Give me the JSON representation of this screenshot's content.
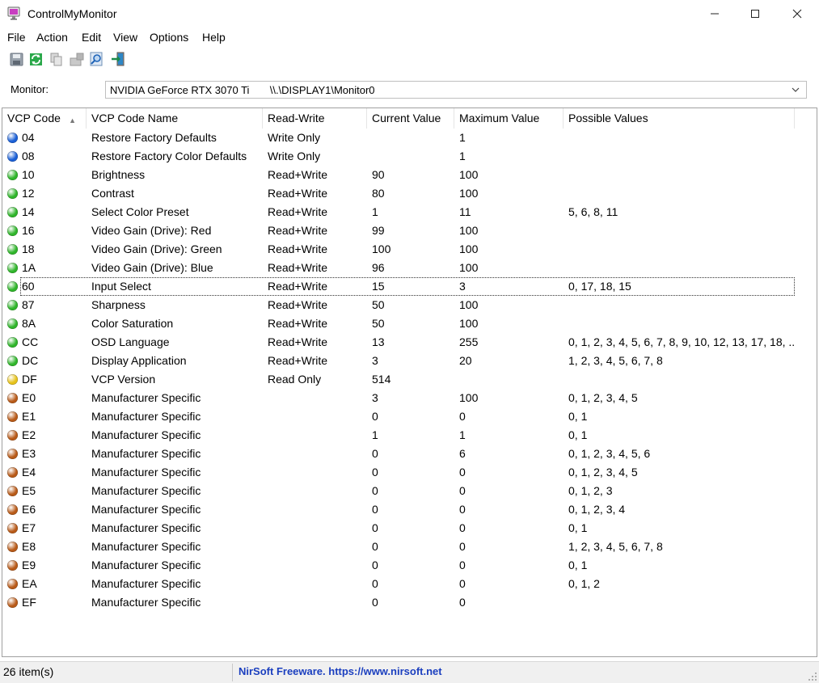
{
  "window": {
    "title": "ControlMyMonitor"
  },
  "menu": [
    "File",
    "Action",
    "Edit",
    "View",
    "Options",
    "Help"
  ],
  "toolbar": [
    "save-icon",
    "refresh-icon",
    "copy-icon",
    "properties-icon",
    "find-icon",
    "exit-icon"
  ],
  "monitor": {
    "label": "Monitor:",
    "value": "NVIDIA GeForce RTX 3070 Ti       \\\\.\\DISPLAY1\\Monitor0"
  },
  "columns": [
    "VCP Code",
    "VCP Code Name",
    "Read-Write",
    "Current Value",
    "Maximum Value",
    "Possible Values"
  ],
  "colors": {
    "blue": "#1a5fd6",
    "green": "#2fb52a",
    "yellow": "#e6c21a",
    "orange": "#b85a18"
  },
  "rows": [
    {
      "code": "04",
      "name": "Restore Factory Defaults",
      "rw": "Write Only",
      "current": "",
      "max": "1",
      "possible": "",
      "color": "blue"
    },
    {
      "code": "08",
      "name": "Restore Factory Color Defaults",
      "rw": "Write Only",
      "current": "",
      "max": "1",
      "possible": "",
      "color": "blue"
    },
    {
      "code": "10",
      "name": "Brightness",
      "rw": "Read+Write",
      "current": "90",
      "max": "100",
      "possible": "",
      "color": "green"
    },
    {
      "code": "12",
      "name": "Contrast",
      "rw": "Read+Write",
      "current": "80",
      "max": "100",
      "possible": "",
      "color": "green"
    },
    {
      "code": "14",
      "name": "Select Color Preset",
      "rw": "Read+Write",
      "current": "1",
      "max": "11",
      "possible": "5, 6, 8, 11",
      "color": "green"
    },
    {
      "code": "16",
      "name": "Video Gain (Drive): Red",
      "rw": "Read+Write",
      "current": "99",
      "max": "100",
      "possible": "",
      "color": "green"
    },
    {
      "code": "18",
      "name": "Video Gain (Drive): Green",
      "rw": "Read+Write",
      "current": "100",
      "max": "100",
      "possible": "",
      "color": "green"
    },
    {
      "code": "1A",
      "name": "Video Gain (Drive): Blue",
      "rw": "Read+Write",
      "current": "96",
      "max": "100",
      "possible": "",
      "color": "green"
    },
    {
      "code": "60",
      "name": "Input Select",
      "rw": "Read+Write",
      "current": "15",
      "max": "3",
      "possible": "0, 17, 18, 15",
      "color": "green",
      "focused": true
    },
    {
      "code": "87",
      "name": "Sharpness",
      "rw": "Read+Write",
      "current": "50",
      "max": "100",
      "possible": "",
      "color": "green"
    },
    {
      "code": "8A",
      "name": "Color Saturation",
      "rw": "Read+Write",
      "current": "50",
      "max": "100",
      "possible": "",
      "color": "green"
    },
    {
      "code": "CC",
      "name": "OSD Language",
      "rw": "Read+Write",
      "current": "13",
      "max": "255",
      "possible": "0, 1, 2, 3, 4, 5, 6, 7, 8, 9, 10, 12, 13, 17, 18, ...",
      "color": "green"
    },
    {
      "code": "DC",
      "name": "Display Application",
      "rw": "Read+Write",
      "current": "3",
      "max": "20",
      "possible": "1, 2, 3, 4, 5, 6, 7, 8",
      "color": "green"
    },
    {
      "code": "DF",
      "name": "VCP Version",
      "rw": "Read Only",
      "current": "514",
      "max": "",
      "possible": "",
      "color": "yellow"
    },
    {
      "code": "E0",
      "name": "Manufacturer Specific",
      "rw": "",
      "current": "3",
      "max": "100",
      "possible": "0, 1, 2, 3, 4, 5",
      "color": "orange"
    },
    {
      "code": "E1",
      "name": "Manufacturer Specific",
      "rw": "",
      "current": "0",
      "max": "0",
      "possible": "0, 1",
      "color": "orange"
    },
    {
      "code": "E2",
      "name": "Manufacturer Specific",
      "rw": "",
      "current": "1",
      "max": "1",
      "possible": "0, 1",
      "color": "orange"
    },
    {
      "code": "E3",
      "name": "Manufacturer Specific",
      "rw": "",
      "current": "0",
      "max": "6",
      "possible": "0, 1, 2, 3, 4, 5, 6",
      "color": "orange"
    },
    {
      "code": "E4",
      "name": "Manufacturer Specific",
      "rw": "",
      "current": "0",
      "max": "0",
      "possible": "0, 1, 2, 3, 4, 5",
      "color": "orange"
    },
    {
      "code": "E5",
      "name": "Manufacturer Specific",
      "rw": "",
      "current": "0",
      "max": "0",
      "possible": "0, 1, 2, 3",
      "color": "orange"
    },
    {
      "code": "E6",
      "name": "Manufacturer Specific",
      "rw": "",
      "current": "0",
      "max": "0",
      "possible": "0, 1, 2, 3, 4",
      "color": "orange"
    },
    {
      "code": "E7",
      "name": "Manufacturer Specific",
      "rw": "",
      "current": "0",
      "max": "0",
      "possible": "0, 1",
      "color": "orange"
    },
    {
      "code": "E8",
      "name": "Manufacturer Specific",
      "rw": "",
      "current": "0",
      "max": "0",
      "possible": "1, 2, 3, 4, 5, 6, 7, 8",
      "color": "orange"
    },
    {
      "code": "E9",
      "name": "Manufacturer Specific",
      "rw": "",
      "current": "0",
      "max": "0",
      "possible": "0, 1",
      "color": "orange"
    },
    {
      "code": "EA",
      "name": "Manufacturer Specific",
      "rw": "",
      "current": "0",
      "max": "0",
      "possible": "0, 1, 2",
      "color": "orange"
    },
    {
      "code": "EF",
      "name": "Manufacturer Specific",
      "rw": "",
      "current": "0",
      "max": "0",
      "possible": "",
      "color": "orange"
    }
  ],
  "status": {
    "count": "26 item(s)",
    "link": "NirSoft Freeware. https://www.nirsoft.net"
  }
}
